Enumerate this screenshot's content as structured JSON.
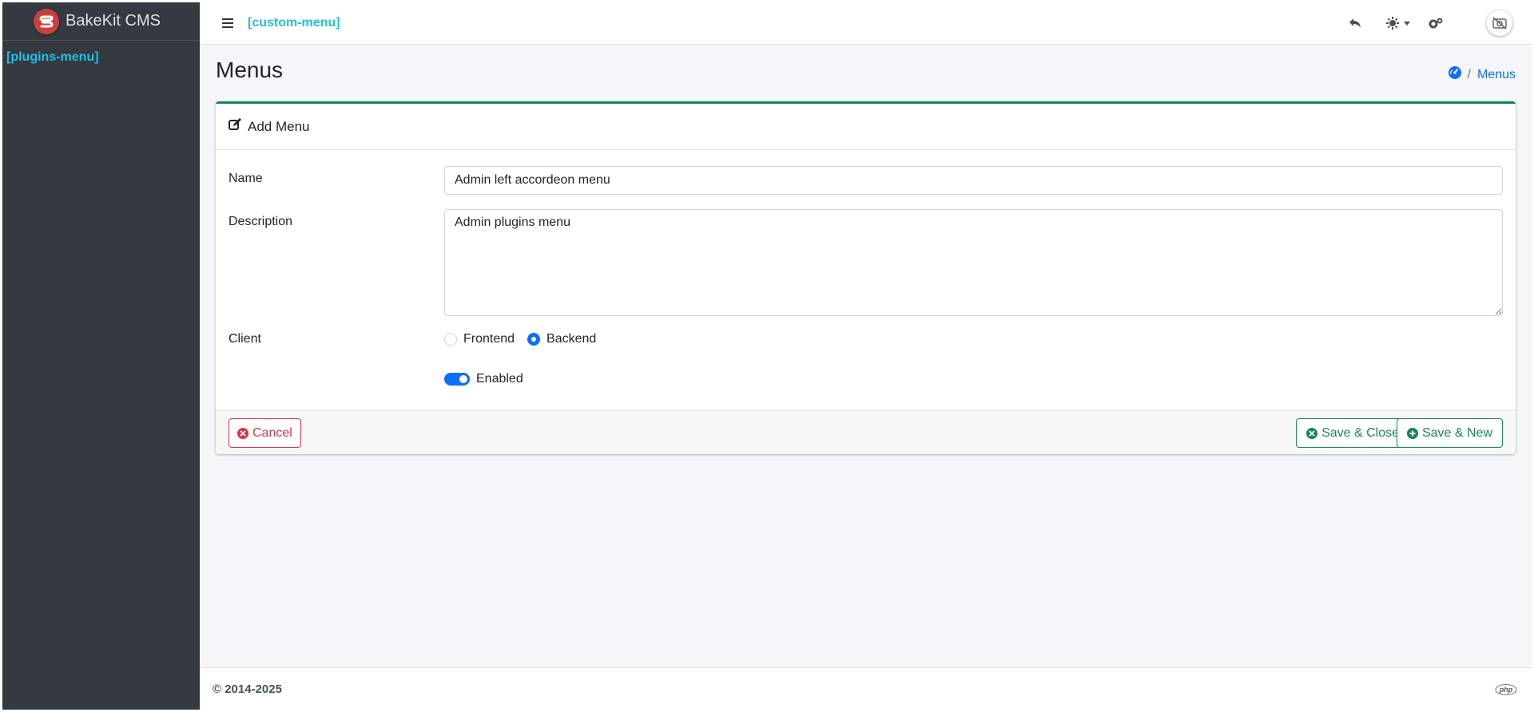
{
  "app": {
    "brand_name": "BakeKit CMS"
  },
  "sidebar": {
    "menu_placeholder": "[plugins-menu]"
  },
  "topbar": {
    "menu_placeholder": "[custom-menu]"
  },
  "page": {
    "title": "Menus",
    "breadcrumb_current": "Menus"
  },
  "card": {
    "header_title": "Add Menu",
    "fields": {
      "name_label": "Name",
      "name_value": "Admin left accordeon menu",
      "description_label": "Description",
      "description_value": "Admin plugins menu",
      "client_label": "Client",
      "client_options": [
        "Frontend",
        "Backend"
      ],
      "client_selected": "Backend",
      "enabled_label": "Enabled",
      "enabled": true
    },
    "buttons": {
      "cancel": "Cancel",
      "save_close": "Save & Close",
      "save_new": "Save & New"
    }
  },
  "footer": {
    "copyright": "© 2014-2025",
    "logo_text": "php"
  },
  "colors": {
    "sidebar_bg": "#343a40",
    "accent_cyan": "#1ec0e6",
    "primary": "#0d6efd",
    "success": "#198754",
    "danger": "#dc3545"
  }
}
